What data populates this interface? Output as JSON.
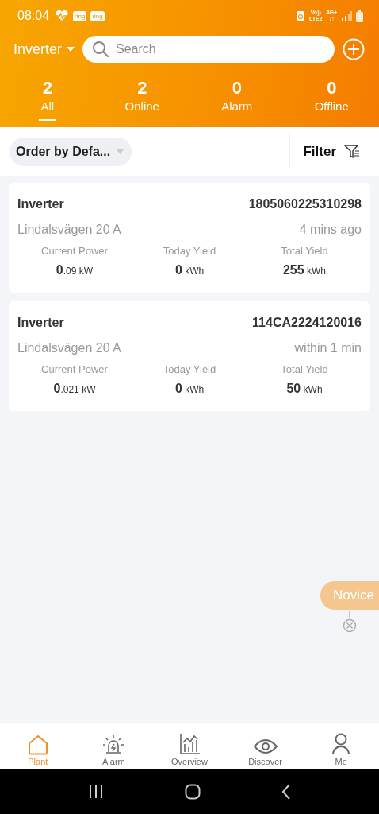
{
  "status_bar": {
    "time": "08:04",
    "badges": [
      "ring",
      "ring"
    ],
    "volte_top": "Vo))",
    "volte_bottom": "LTE2",
    "network_top": "4G+",
    "network_bottom": "↓↑"
  },
  "header": {
    "device_type": "Inverter",
    "search": {
      "placeholder": "Search"
    }
  },
  "tabs": [
    {
      "count": "2",
      "label": "All",
      "selected": true
    },
    {
      "count": "2",
      "label": "Online",
      "selected": false
    },
    {
      "count": "0",
      "label": "Alarm",
      "selected": false
    },
    {
      "count": "0",
      "label": "Offline",
      "selected": false
    }
  ],
  "sort": {
    "label": "Order by Defa..."
  },
  "filter": {
    "label": "Filter"
  },
  "devices": [
    {
      "name": "Inverter",
      "serial": "1805060225310298",
      "address": "Lindalsvägen 20 A",
      "updated": "4 mins ago",
      "metrics": [
        {
          "label": "Current Power",
          "value": "0",
          "fraction": ".09",
          "unit": "kW"
        },
        {
          "label": "Today Yield",
          "value": "0",
          "unit": "kWh"
        },
        {
          "label": "Total Yield",
          "value": "255",
          "unit": "kWh"
        }
      ]
    },
    {
      "name": "Inverter",
      "serial": "114CA2224120016",
      "address": "Lindalsvägen 20 A",
      "updated": "within 1 min",
      "metrics": [
        {
          "label": "Current Power",
          "value": "0",
          "fraction": ".021",
          "unit": "kW"
        },
        {
          "label": "Today Yield",
          "value": "0",
          "unit": "kWh"
        },
        {
          "label": "Total Yield",
          "value": "50",
          "unit": "kWh"
        }
      ]
    }
  ],
  "novice": {
    "label": "Novice"
  },
  "bottom_nav": [
    {
      "kind": "home",
      "label": "Plant",
      "selected": true
    },
    {
      "kind": "alarm",
      "label": "Alarm",
      "selected": false
    },
    {
      "kind": "chart",
      "label": "Overview",
      "selected": false
    },
    {
      "kind": "eye",
      "label": "Discover",
      "selected": false
    },
    {
      "kind": "person",
      "label": "Me",
      "selected": false
    }
  ]
}
